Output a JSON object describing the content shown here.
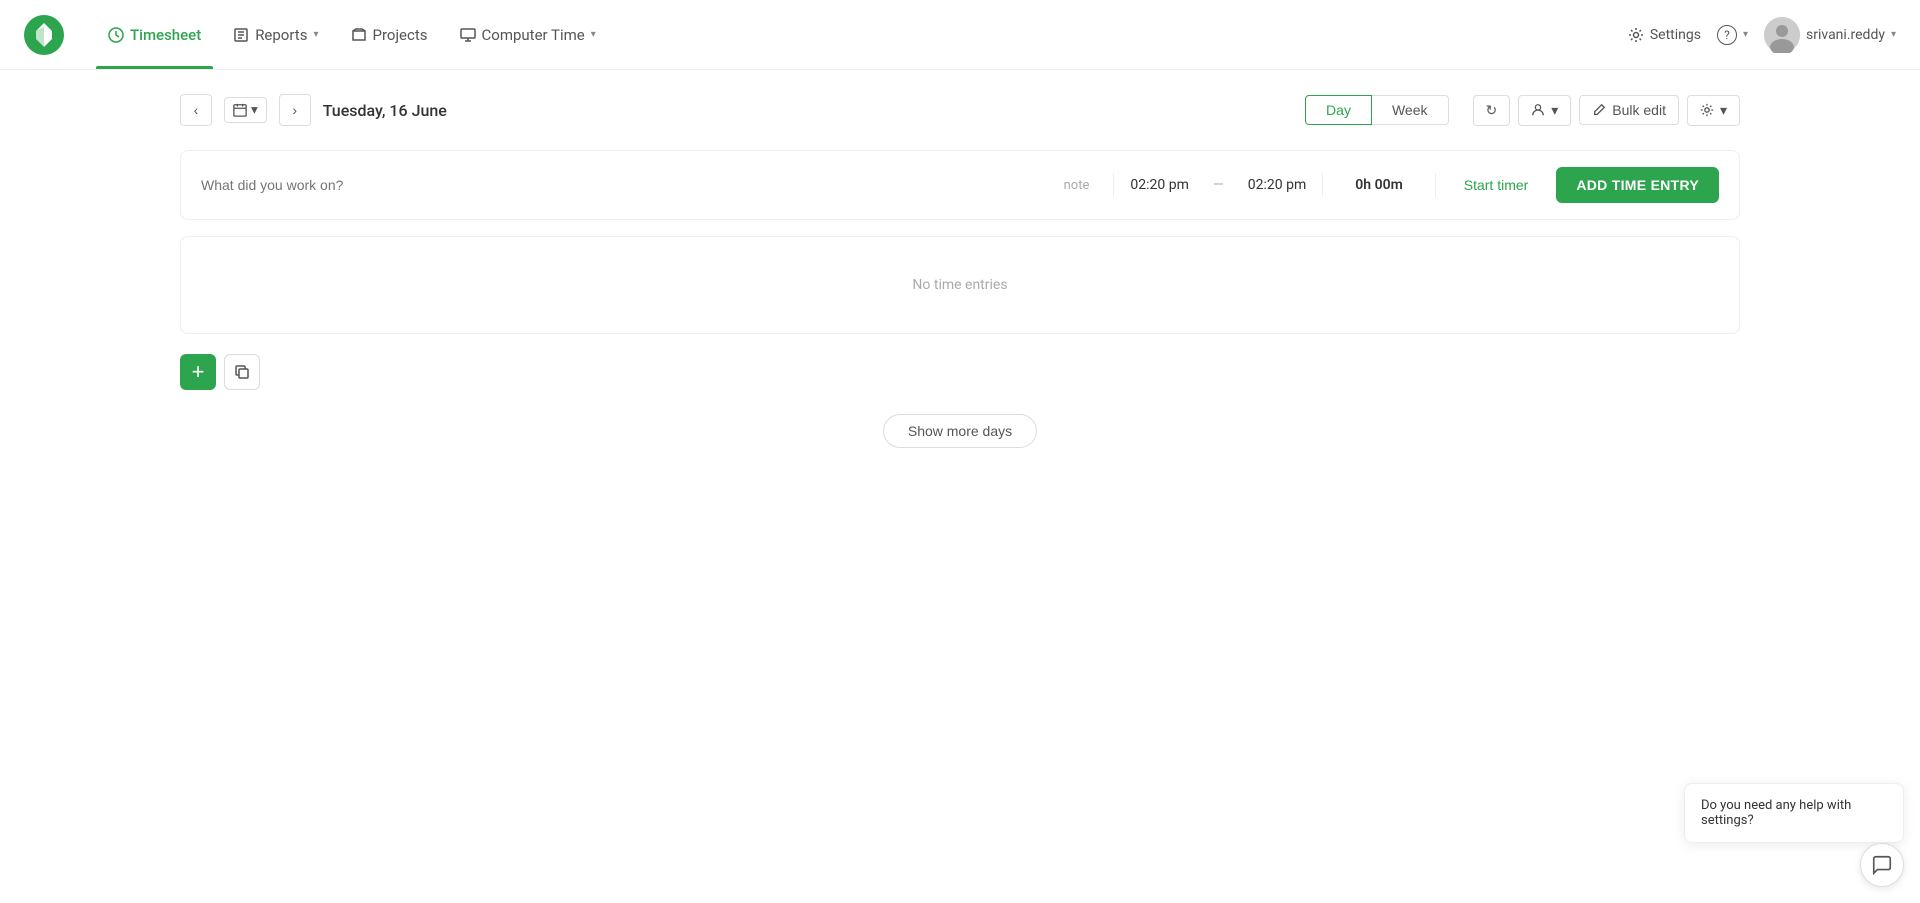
{
  "nav": {
    "logo_alt": "Toggl logo",
    "items": [
      {
        "id": "timesheet",
        "label": "Timesheet",
        "active": true,
        "icon": "clock-icon"
      },
      {
        "id": "reports",
        "label": "Reports",
        "active": false,
        "icon": "reports-icon"
      },
      {
        "id": "projects",
        "label": "Projects",
        "active": false,
        "icon": "projects-icon"
      },
      {
        "id": "computer-time",
        "label": "Computer Time",
        "active": false,
        "icon": "computer-icon"
      }
    ],
    "settings_label": "Settings",
    "help_label": "?",
    "user_label": "srivani.reddy"
  },
  "date_bar": {
    "date_label": "Tuesday, 16 June",
    "view_day": "Day",
    "view_week": "Week",
    "bulk_edit": "Bulk edit"
  },
  "time_entry_row": {
    "placeholder": "What did you work on?",
    "note_label": "note",
    "start_time": "02:20 pm",
    "end_time": "02:20 pm",
    "duration": "0h 00m",
    "start_timer_label": "Start timer",
    "add_entry_label": "ADD TIME ENTRY"
  },
  "entries_area": {
    "empty_label": "No time entries"
  },
  "show_more": {
    "label": "Show more days"
  },
  "chat": {
    "bubble_text": "Do you need any help with settings?",
    "icon": "chat-icon"
  },
  "icons": {
    "clock": "⏱",
    "chevron_down": "▾",
    "calendar": "📅",
    "refresh": "↻",
    "person": "👤",
    "gear": "⚙",
    "edit": "✏",
    "plus": "+",
    "copy": "❏",
    "prev": "‹",
    "next": "›",
    "chat": "💬"
  }
}
